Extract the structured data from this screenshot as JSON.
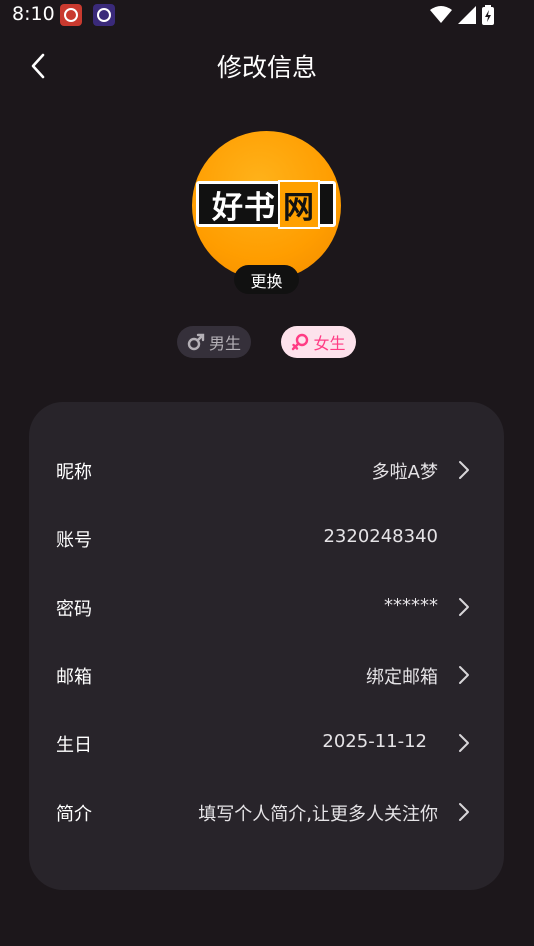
{
  "status_bar": {
    "time": "8:10"
  },
  "header": {
    "title": "修改信息"
  },
  "avatar": {
    "logo_text_main": "好书",
    "logo_text_box": "网",
    "change_label": "更换"
  },
  "gender": {
    "male_label": "男生",
    "female_label": "女生",
    "selected": "female"
  },
  "profile_rows": [
    {
      "label": "昵称",
      "value": "多啦A梦",
      "has_arrow": true
    },
    {
      "label": "账号",
      "value": "2320248340",
      "has_arrow": false
    },
    {
      "label": "密码",
      "value": "******",
      "has_arrow": true
    },
    {
      "label": "邮箱",
      "value": "绑定邮箱",
      "has_arrow": true
    },
    {
      "label": "生日",
      "value": "2025-11-12",
      "has_arrow": true
    },
    {
      "label": "简介",
      "value": "填写个人简介,让更多人关注你",
      "has_arrow": true
    }
  ],
  "colors": {
    "background": "#1c171b",
    "card": "#28242a",
    "female_accent": "#ff3b84",
    "avatar_orange": "#ff9d00"
  }
}
